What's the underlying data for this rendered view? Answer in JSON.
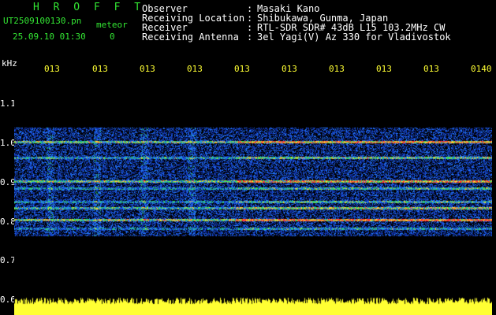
{
  "header": {
    "title": "H R O F F T",
    "filename": "UT2509100130.pn",
    "meteor_label": "meteor",
    "datetime": "25.09.10 01:30",
    "count": "0"
  },
  "info": [
    {
      "label": "Observer",
      "value": "Masaki Kano"
    },
    {
      "label": "Receiving Location",
      "value": "Shibukawa, Gunma, Japan"
    },
    {
      "label": "Receiver",
      "value": "RTL-SDR SDR# 43dB L15 103.2MHz CW"
    },
    {
      "label": "Receiving Antenna",
      "value": "3el Yagi(V) Az 330 for Vladivostok"
    }
  ],
  "colon": ":",
  "axis": {
    "y_unit": "kHz",
    "y_ticks": [
      "1.1",
      "1.0",
      "0.9",
      "0.8",
      "0.7",
      "0.6"
    ],
    "x_ticks": [
      "013",
      "013",
      "013",
      "013",
      "013",
      "013",
      "013",
      "013",
      "013",
      "0140"
    ]
  },
  "colors": {
    "text_green": "#33e633",
    "text_yellow": "#ffff33",
    "background": "#000000",
    "power_bar": "#ffff33"
  }
}
